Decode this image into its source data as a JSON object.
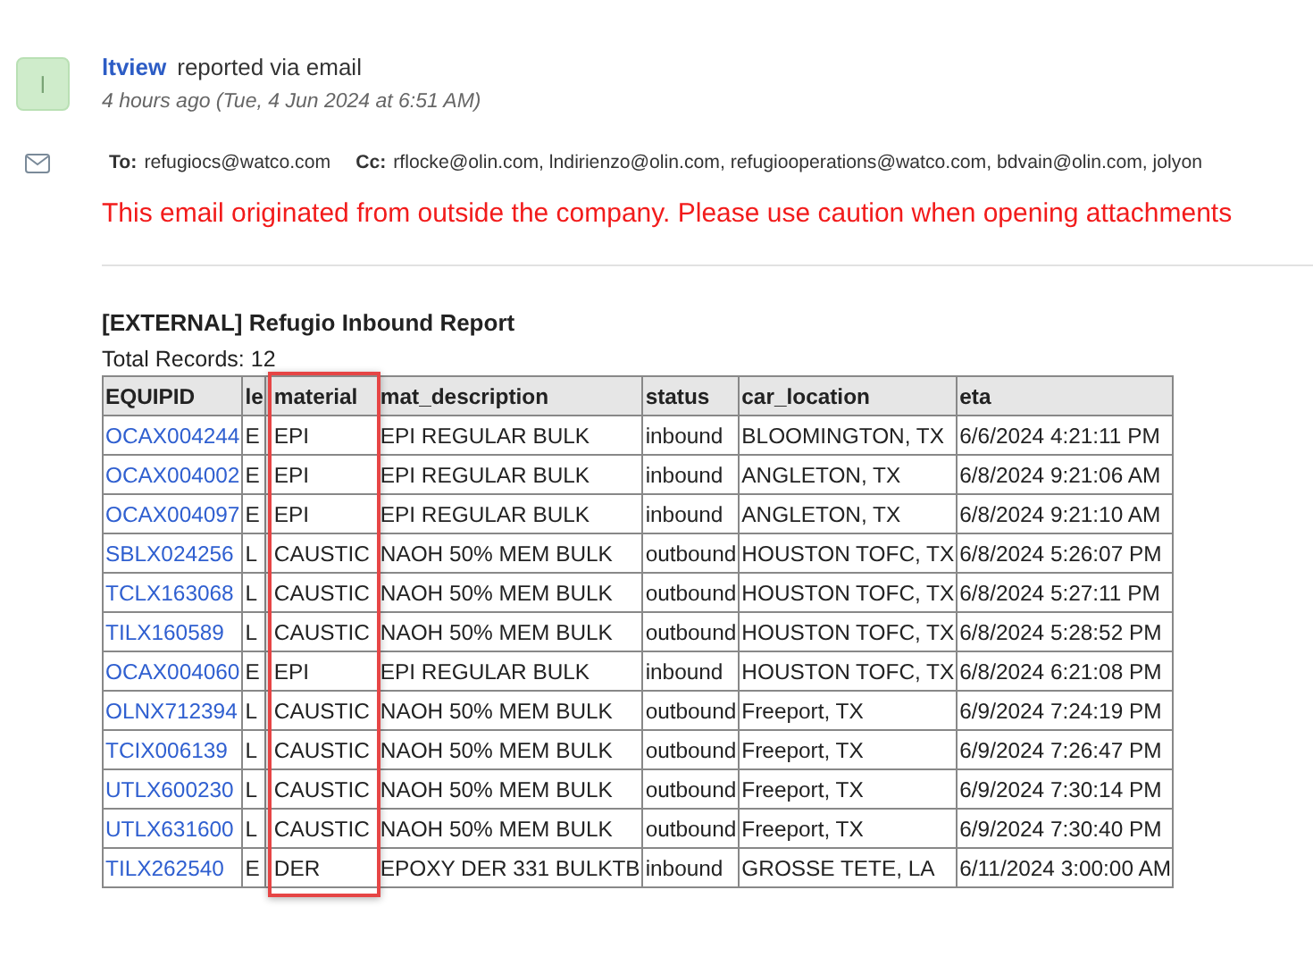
{
  "sender": {
    "avatar": "l",
    "name": "ltview",
    "action": "reported via email",
    "time": "4 hours ago (Tue, 4 Jun 2024 at 6:51 AM)"
  },
  "recipients": {
    "to_label": "To:",
    "to": "refugiocs@watco.com",
    "cc_label": "Cc:",
    "cc": "rflocke@olin.com, lndirienzo@olin.com, refugiooperations@watco.com, bdvain@olin.com, jolyon"
  },
  "warning": "This email originated from outside the company. Please use caution when opening attachments",
  "report": {
    "title": "[EXTERNAL] Refugio Inbound Report",
    "total": "Total Records: 12",
    "columns": [
      {
        "label": "EQUIPID",
        "highlighted": false
      },
      {
        "label": "le",
        "highlighted": false
      },
      {
        "label": "material",
        "highlighted": true
      },
      {
        "label": "mat_description",
        "highlighted": false
      },
      {
        "label": "status",
        "highlighted": false
      },
      {
        "label": "car_location",
        "highlighted": false
      },
      {
        "label": "eta",
        "highlighted": false
      }
    ],
    "rows": [
      [
        "OCAX004244",
        "E",
        "EPI",
        "EPI REGULAR BULK",
        "inbound",
        "BLOOMINGTON, TX",
        "6/6/2024 4:21:11 PM"
      ],
      [
        "OCAX004002",
        "E",
        "EPI",
        "EPI REGULAR BULK",
        "inbound",
        "ANGLETON, TX",
        "6/8/2024 9:21:06 AM"
      ],
      [
        "OCAX004097",
        "E",
        "EPI",
        "EPI REGULAR BULK",
        "inbound",
        "ANGLETON, TX",
        "6/8/2024 9:21:10 AM"
      ],
      [
        "SBLX024256",
        "L",
        "CAUSTIC",
        "NAOH 50% MEM BULK",
        "outbound",
        "HOUSTON TOFC, TX",
        "6/8/2024 5:26:07 PM"
      ],
      [
        "TCLX163068",
        "L",
        "CAUSTIC",
        "NAOH 50% MEM BULK",
        "outbound",
        "HOUSTON TOFC, TX",
        "6/8/2024 5:27:11 PM"
      ],
      [
        "TILX160589",
        "L",
        "CAUSTIC",
        "NAOH 50% MEM BULK",
        "outbound",
        "HOUSTON TOFC, TX",
        "6/8/2024 5:28:52 PM"
      ],
      [
        "OCAX004060",
        "E",
        "EPI",
        "EPI REGULAR BULK",
        "inbound",
        "HOUSTON TOFC, TX",
        "6/8/2024 6:21:08 PM"
      ],
      [
        "OLNX712394",
        "L",
        "CAUSTIC",
        "NAOH 50% MEM BULK",
        "outbound",
        "Freeport, TX",
        "6/9/2024 7:24:19 PM"
      ],
      [
        "TCIX006139",
        "L",
        "CAUSTIC",
        "NAOH 50% MEM BULK",
        "outbound",
        "Freeport, TX",
        "6/9/2024 7:26:47 PM"
      ],
      [
        "UTLX600230",
        "L",
        "CAUSTIC",
        "NAOH 50% MEM BULK",
        "outbound",
        "Freeport, TX",
        "6/9/2024 7:30:14 PM"
      ],
      [
        "UTLX631600",
        "L",
        "CAUSTIC",
        "NAOH 50% MEM BULK",
        "outbound",
        "Freeport, TX",
        "6/9/2024 7:30:40 PM"
      ],
      [
        "TILX262540",
        "E",
        "DER",
        "EPOXY DER 331 BULKTB",
        "inbound",
        "GROSSE TETE, LA",
        "6/11/2024 3:00:00 AM"
      ]
    ]
  }
}
